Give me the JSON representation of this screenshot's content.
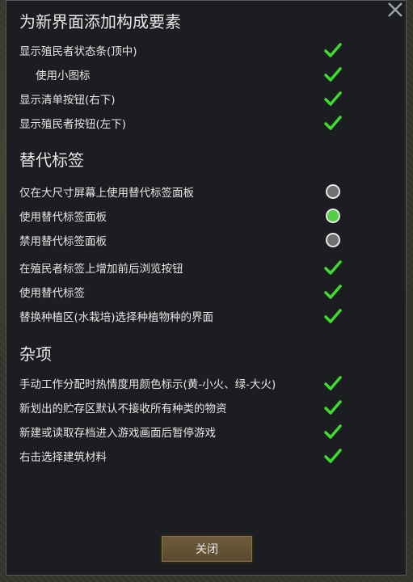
{
  "sections": [
    {
      "title": "为新界面添加构成要素",
      "items": [
        {
          "label": "显示殖民者状态条(顶中)",
          "control": "check",
          "indent": false
        },
        {
          "label": "使用小图标",
          "control": "check",
          "indent": true
        },
        {
          "label": "显示清单按钮(右下)",
          "control": "check",
          "indent": false
        },
        {
          "label": "显示殖民者按钮(左下)",
          "control": "check",
          "indent": false
        }
      ]
    },
    {
      "title": "替代标签",
      "items": [
        {
          "label": "仅在大尺寸屏幕上使用替代标签面板",
          "control": "radio",
          "selected": false
        },
        {
          "label": "使用替代标签面板",
          "control": "radio",
          "selected": true
        },
        {
          "label": "禁用替代标签面板",
          "control": "radio",
          "selected": false
        },
        {
          "label": "在殖民者标签上增加前后浏览按钮",
          "control": "check"
        },
        {
          "label": "使用替代标签",
          "control": "check"
        },
        {
          "label": "替换种植区(水栽培)选择种植物种的界面",
          "control": "check"
        }
      ]
    },
    {
      "title": "杂项",
      "items": [
        {
          "label": "手动工作分配时热情度用颜色标示(黄-小火、绿-大火)",
          "control": "check"
        },
        {
          "label": "新划出的贮存区默认不接收所有种类的物资",
          "control": "check"
        },
        {
          "label": "新建或读取存档进入游戏画面后暂停游戏",
          "control": "check"
        },
        {
          "label": "右击选择建筑材料",
          "control": "check"
        }
      ]
    }
  ],
  "close_button": "关闭",
  "colors": {
    "check": "#3ddc2e",
    "radio_on": "#4fd143",
    "radio_off": "#707070",
    "panel_bg": "#1b1d20"
  }
}
